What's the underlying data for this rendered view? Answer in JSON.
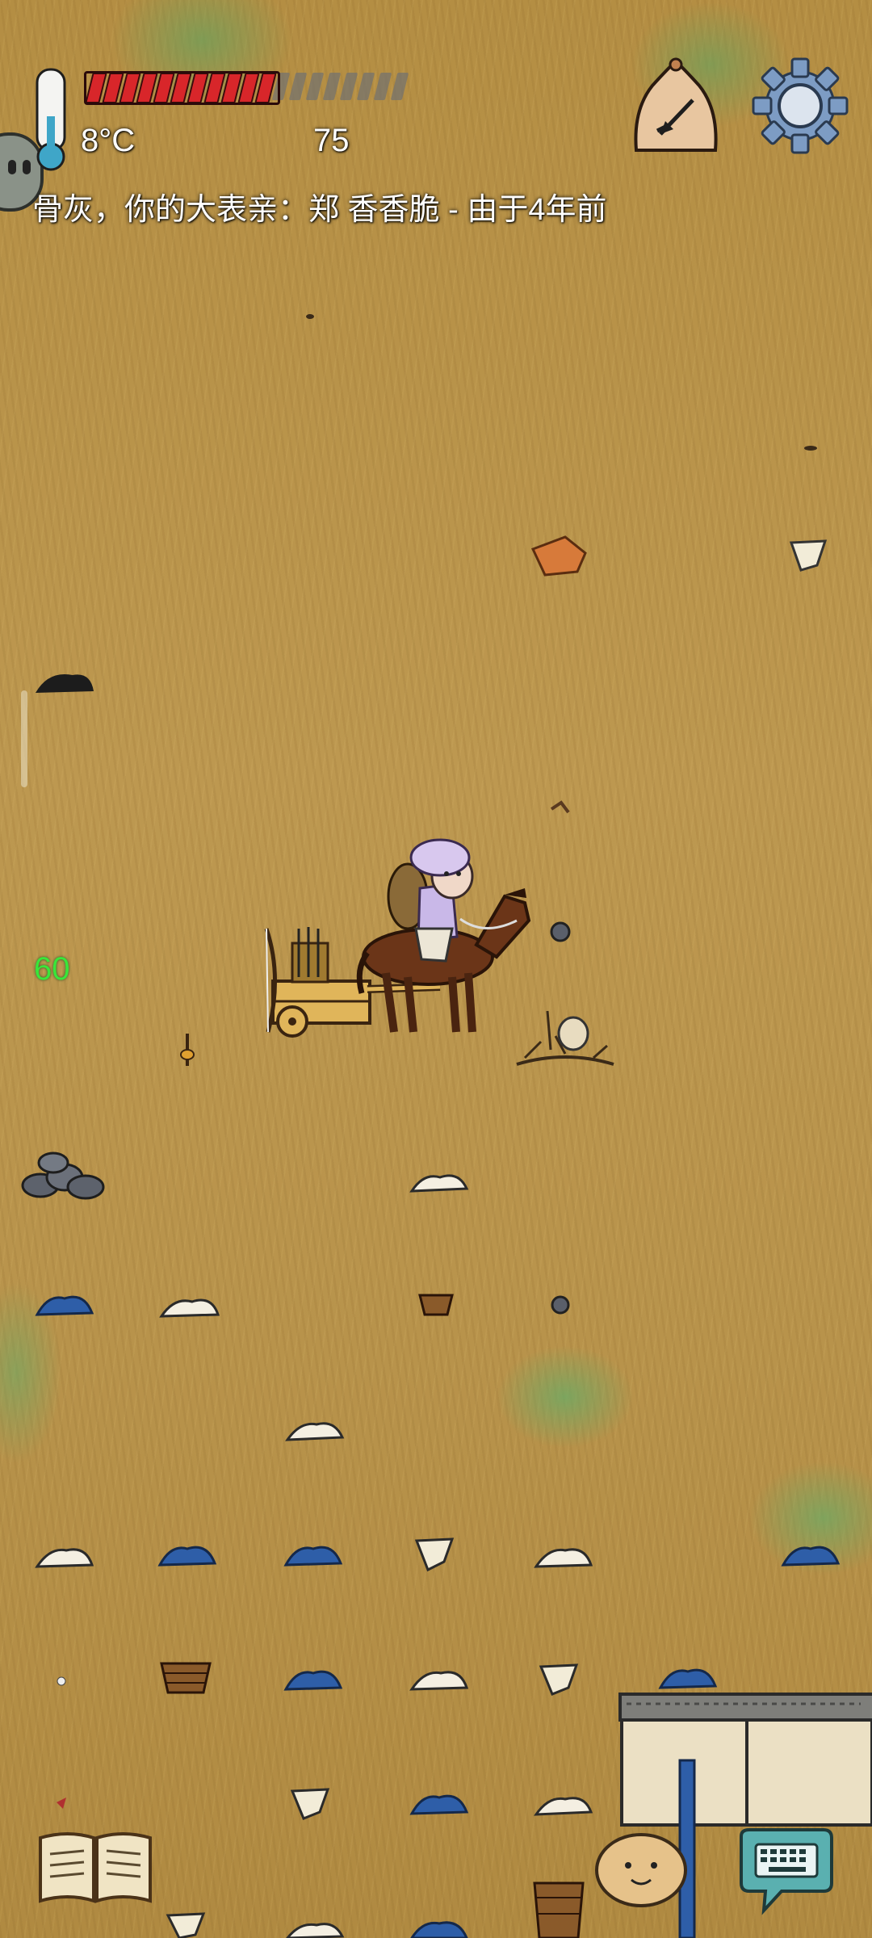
{
  "hud": {
    "temperature": "8°C",
    "age": "75",
    "food_pips_filled": 11,
    "food_pips_total": 19,
    "message": "骨灰，你的大表亲：郑 香香脆 - 由于4年前",
    "fps": "60"
  },
  "icons": {
    "thermometer": "thermometer-icon",
    "compass": "home-compass-icon",
    "settings": "gear-icon",
    "tech_book": "recipe-book-icon",
    "emote": "emote-face-icon",
    "keyboard": "keyboard-chat-icon"
  },
  "colors": {
    "food_filled": "#d8262a",
    "food_empty": "#707070",
    "fps_green": "#39e639",
    "grass_dry": "#b8934b",
    "grass_green": "#6ea05a"
  }
}
